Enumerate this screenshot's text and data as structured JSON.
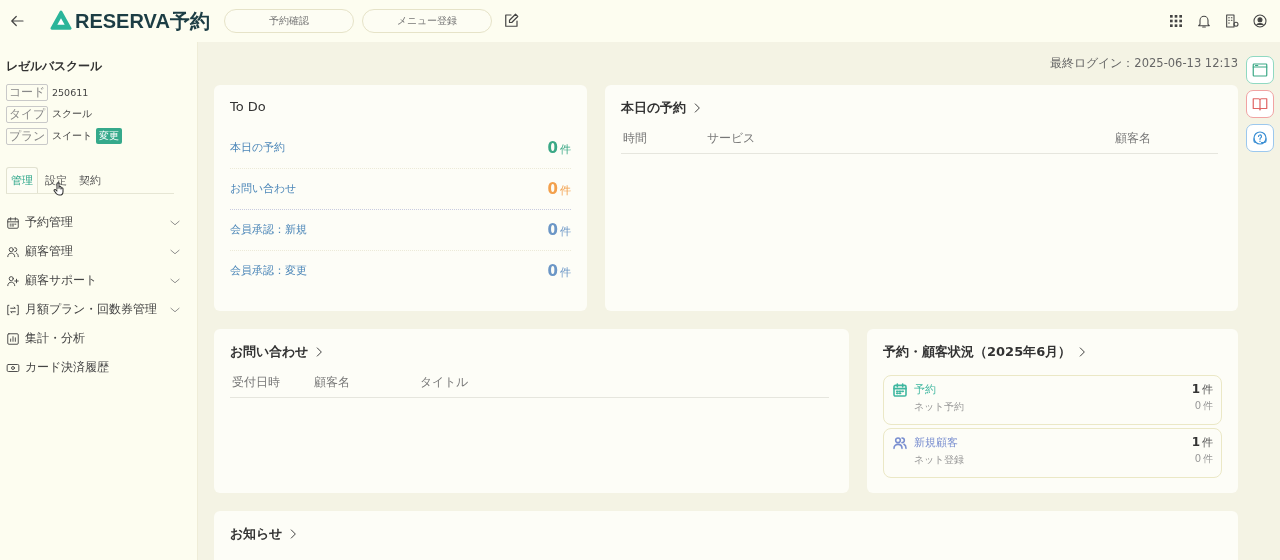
{
  "header": {
    "logo": "RESERVA予約",
    "nav_buttons": [
      "予約確認",
      "メニュー登録"
    ]
  },
  "sidebar": {
    "shop_name": "レゼルバスクール",
    "info": [
      {
        "label": "コード",
        "value": "250611"
      },
      {
        "label": "タイプ",
        "value": "スクール"
      },
      {
        "label": "プラン",
        "value": "スイート",
        "badge": "変更"
      }
    ],
    "tabs": [
      {
        "label": "管理",
        "selected": true
      },
      {
        "label": "設定",
        "selected": false
      },
      {
        "label": "契約",
        "selected": false
      }
    ],
    "menu": [
      {
        "label": "予約管理",
        "expandable": true
      },
      {
        "label": "顧客管理",
        "expandable": true
      },
      {
        "label": "顧客サポート",
        "expandable": true
      },
      {
        "label": "月額プラン・回数券管理",
        "expandable": true
      },
      {
        "label": "集計・分析",
        "expandable": false
      },
      {
        "label": "カード決済履歴",
        "expandable": false
      }
    ]
  },
  "main": {
    "last_login": "最終ログイン：2025-06-13 12:13",
    "todo": {
      "title": "To Do",
      "items": [
        {
          "label": "本日の予約",
          "count": "0",
          "unit": "件",
          "color": "#3aa886"
        },
        {
          "label": "お問い合わせ",
          "count": "0",
          "unit": "件",
          "color": "#f3a04c"
        },
        {
          "label": "会員承認：新規",
          "count": "0",
          "unit": "件",
          "color": "#6b96c6"
        },
        {
          "label": "会員承認：変更",
          "count": "0",
          "unit": "件",
          "color": "#6b96c6"
        }
      ]
    },
    "today": {
      "title": "本日の予約",
      "columns": [
        "時間",
        "サービス",
        "顧客名"
      ]
    },
    "inquiries": {
      "title": "お問い合わせ",
      "columns": [
        "受付日時",
        "顧客名",
        "タイトル"
      ]
    },
    "status": {
      "title": "予約・顧客状況（2025年6月）",
      "items": [
        {
          "label": "予約",
          "color": "#3fb7a0",
          "count": "1",
          "unit": "件",
          "sub_label": "ネット予約",
          "sub_count": "0",
          "sub_unit": "件"
        },
        {
          "label": "新規顧客",
          "color": "#7a8fd0",
          "count": "1",
          "unit": "件",
          "sub_label": "ネット登録",
          "sub_count": "0",
          "sub_unit": "件"
        }
      ]
    },
    "news": {
      "title": "お知らせ"
    }
  }
}
